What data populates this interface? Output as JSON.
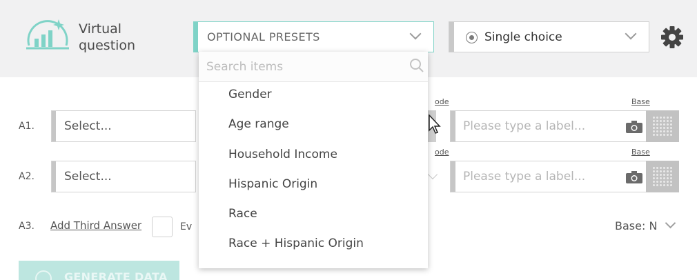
{
  "app": {
    "title_line1": "Virtual",
    "title_line2": "question"
  },
  "presets": {
    "label": "OPTIONAL PRESETS"
  },
  "answer_type": {
    "selected": "Single choice"
  },
  "answers": [
    {
      "row_label": "A1.",
      "select_value": "Select...",
      "code_link": "ode",
      "base_link": "Base",
      "label_placeholder": "Please type a label..."
    },
    {
      "row_label": "A2.",
      "select_value": "Select...",
      "code_link": "ode",
      "base_link": "Base",
      "label_placeholder": "Please type a label..."
    }
  ],
  "third": {
    "row_label": "A3.",
    "add_link": "Add Third Answer",
    "checkbox_text": "Ev"
  },
  "base": {
    "value": "Base: N"
  },
  "generate": {
    "label": "GENERATE DATA"
  },
  "dropdown": {
    "search_placeholder": "Search items",
    "items": [
      "Gender",
      "Age range",
      "Household Income",
      "Hispanic Origin",
      "Race",
      "Race + Hispanic Origin"
    ]
  },
  "colors": {
    "accent": "#7fd3c7",
    "header_bg": "#f1f1f2",
    "button_disabled": "#bde6e0"
  }
}
